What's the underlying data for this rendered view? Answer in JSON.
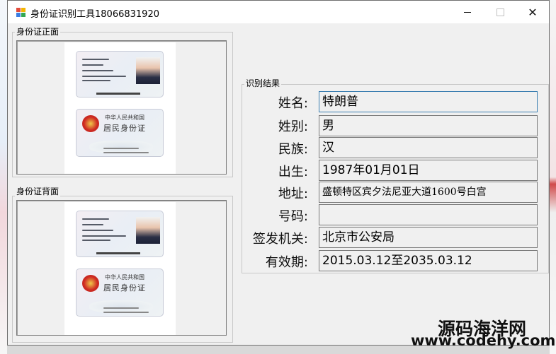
{
  "window": {
    "title": "身份证识别工具18066831920"
  },
  "front_group": {
    "label": "身份证正面"
  },
  "back_group": {
    "label": "身份证背面"
  },
  "card_text": {
    "back_line1": "中华人民共和国",
    "back_line2": "居民身份证"
  },
  "results": {
    "label": "识别结果",
    "fields": [
      {
        "label": "姓名:",
        "value": "特朗普"
      },
      {
        "label": "姓别:",
        "value": "男"
      },
      {
        "label": "民族:",
        "value": "汉"
      },
      {
        "label": "出生:",
        "value": "1987年01月01日"
      },
      {
        "label": "地址:",
        "value": "盛顿特区宾夕法尼亚大道1600号白宫"
      },
      {
        "label": "号码:",
        "value": ""
      },
      {
        "label": "签发机关:",
        "value": "北京市公安局"
      },
      {
        "label": "有效期:",
        "value": "2015.03.12至2035.03.12"
      }
    ]
  },
  "watermark": {
    "line1": "源码海洋网",
    "line2": "www.codehy.com"
  },
  "colors": {
    "window_bg": "#f0f0f0",
    "focus_border": "#3c7fb1",
    "emblem_red": "#d02b22"
  },
  "icons": [
    "app-icon",
    "minimize-icon",
    "maximize-icon",
    "close-icon",
    "national-emblem-icon",
    "portrait-photo-icon"
  ]
}
